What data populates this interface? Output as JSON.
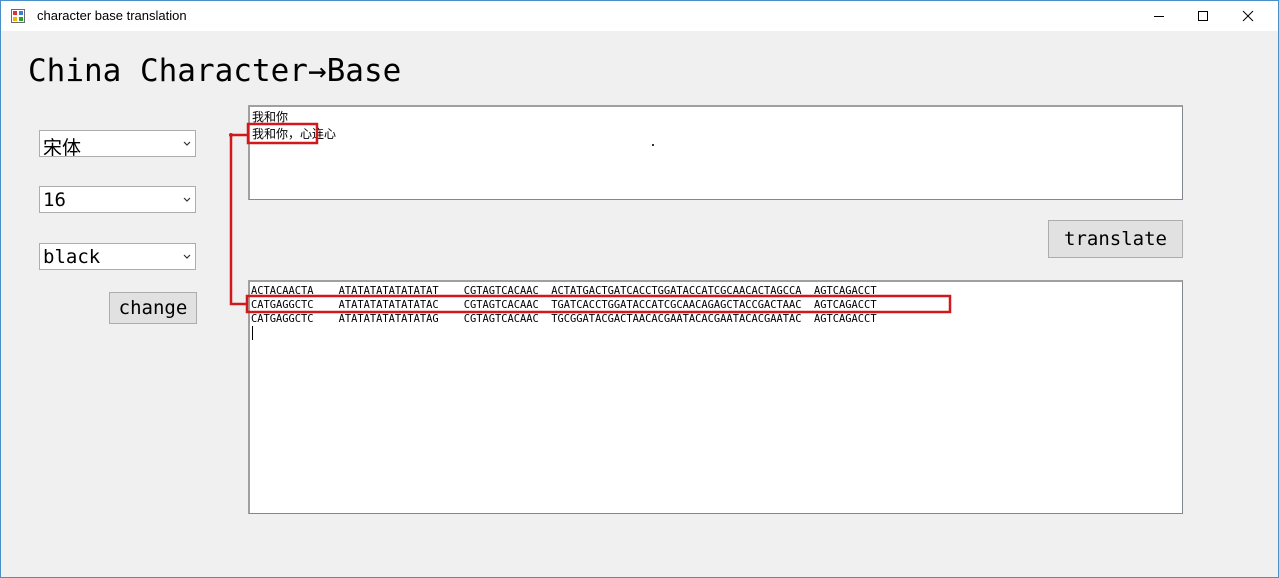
{
  "window": {
    "title": "character base translation",
    "controls": [
      "minimize",
      "maximize",
      "close"
    ]
  },
  "heading": "China Character→Base",
  "font_combo": {
    "value": "宋体"
  },
  "size_combo": {
    "value": "16"
  },
  "color_combo": {
    "value": "black"
  },
  "change_button": {
    "label": "change"
  },
  "translate_button": {
    "label": "translate"
  },
  "input_text": {
    "lines": [
      "我和你",
      "我和你，心连心"
    ]
  },
  "output_text": {
    "lines": [
      "ACTACAACTA    ATATATATATATATAT    CGTAGTCACAAC  ACTATGACTGATCACCTGGATACCATCGCAACACTAGCCA  AGTCAGACCT",
      "CATGAGGCTC    ATATATATATATATAC    CGTAGTCACAAC  TGATCACCTGGATACCATCGCAACAGAGCTACCGACTAAC  AGTCAGACCT",
      "CATGAGGCTC    ATATATATATATATAG    CGTAGTCACAAC  TGCGGATACGACTAACACGAATACACGAATACACGAATAC  AGTCAGACCT"
    ]
  },
  "colors": {
    "annotation": "#d0191c",
    "window_border": "#4a90c8",
    "background": "#f0f0f0"
  }
}
